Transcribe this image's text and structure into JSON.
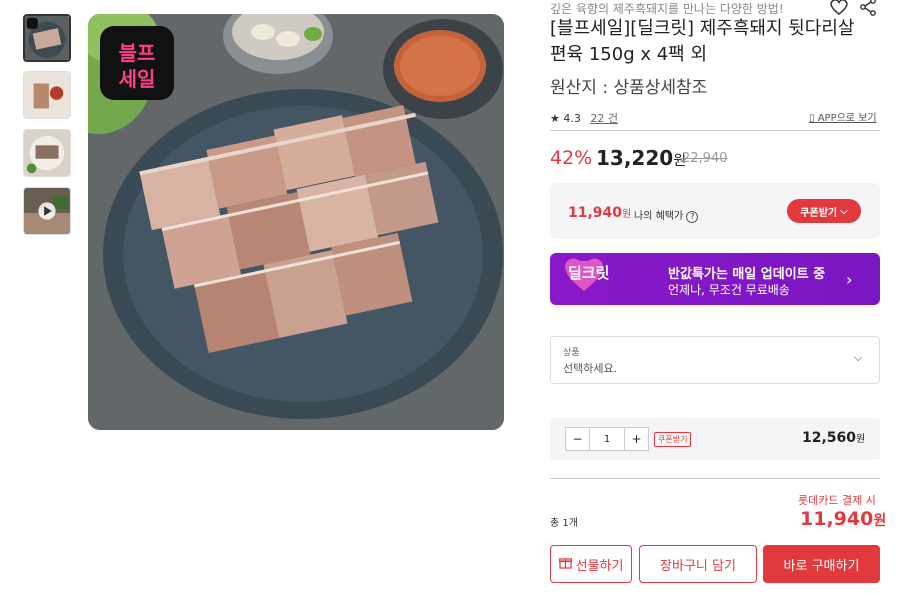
{
  "product": {
    "subtitle": "깊은 육향의 제주흑돼지를 만나는 다양한 방법!",
    "title": "[블프세일][딜크릿] 제주흑돼지 뒷다리살 편육 150g x 4팩 외",
    "origin": "원산지 : 상품상세참조",
    "rating": "4.3",
    "review_count": "22 건",
    "app_link": "APP으로 보기",
    "badge_text_line1": "블프",
    "badge_text_line2": "세일"
  },
  "pricing": {
    "discount": "42%",
    "price": "13,220",
    "currency": "원",
    "original_price": "22,940"
  },
  "benefit": {
    "price": "11,940",
    "currency": "원",
    "label": "나의 혜택가",
    "coupon_button": "쿠폰받기"
  },
  "banner": {
    "logo": "딜크릿",
    "line1": "반값특가는 매일 업데이트 중",
    "line2": "언제나, 무조건 무료배송"
  },
  "option_select": {
    "label": "상품",
    "placeholder": "선택하세요."
  },
  "quantity": {
    "minus": "−",
    "value": "1",
    "plus": "+",
    "coupon_tag": "쿠폰받기",
    "price": "12,560",
    "currency": "원"
  },
  "total": {
    "card_note": "롯데카드 결제 시",
    "count": "총 1개",
    "price": "11,940",
    "currency": "원"
  },
  "buttons": {
    "gift": "선물하기",
    "cart": "장바구니 담기",
    "buy": "바로 구매하기"
  },
  "colors": {
    "accent": "#e0393e",
    "banner": "#8a19c9"
  }
}
